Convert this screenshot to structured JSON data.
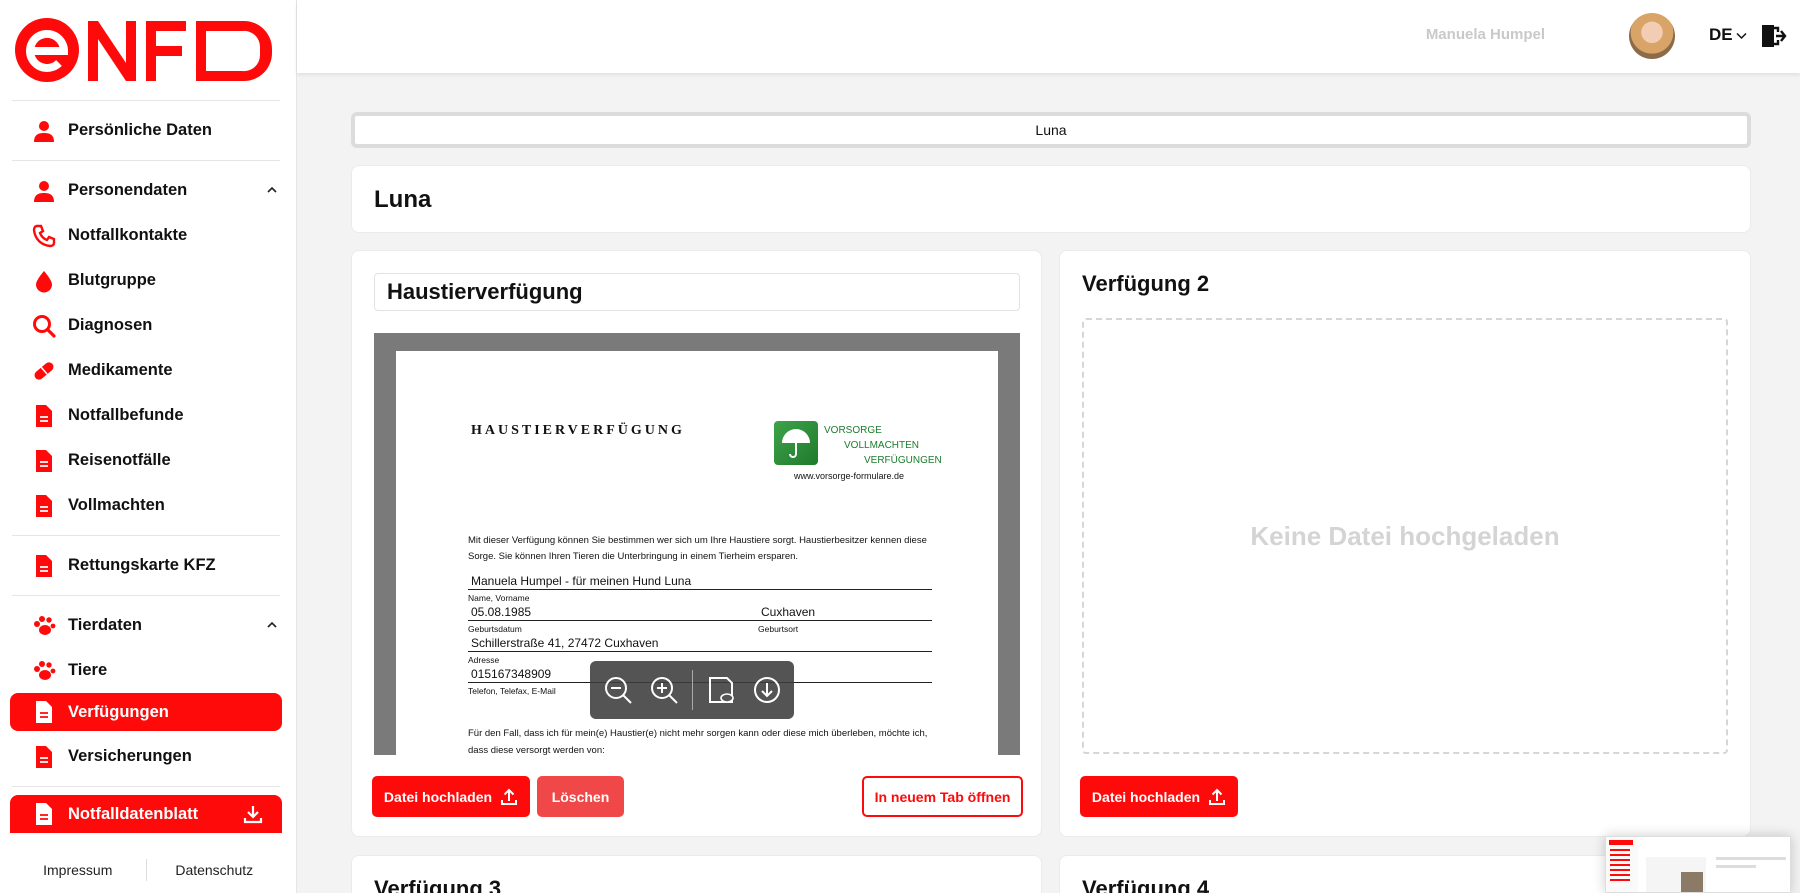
{
  "brand": {
    "name": "eNFD",
    "color": "#ff0a0a"
  },
  "header": {
    "username": "Manuela Humpel",
    "language": "DE"
  },
  "sidebar": {
    "items": [
      {
        "label": "Persönliche Daten",
        "icon": "person-icon"
      },
      {
        "label": "Personendaten",
        "icon": "person-icon"
      },
      {
        "label": "Notfallkontakte",
        "icon": "phone-icon"
      },
      {
        "label": "Blutgruppe",
        "icon": "drop-icon"
      },
      {
        "label": "Diagnosen",
        "icon": "search-icon"
      },
      {
        "label": "Medikamente",
        "icon": "pill-icon"
      },
      {
        "label": "Notfallbefunde",
        "icon": "document-icon"
      },
      {
        "label": "Reisenotfälle",
        "icon": "document-icon"
      },
      {
        "label": "Vollmachten",
        "icon": "document-icon"
      },
      {
        "label": "Rettungskarte KFZ",
        "icon": "document-icon"
      },
      {
        "label": "Tierdaten",
        "icon": "paw-icon"
      },
      {
        "label": "Tiere",
        "icon": "paw-icon"
      },
      {
        "label": "Verfügungen",
        "icon": "document-icon"
      },
      {
        "label": "Versicherungen",
        "icon": "document-icon"
      },
      {
        "label": "Notfalldatenblatt",
        "icon": "document-icon"
      }
    ],
    "footer": {
      "impressum": "Impressum",
      "datenschutz": "Datenschutz"
    }
  },
  "main": {
    "selector": "Luna",
    "title": "Luna",
    "card1": {
      "title": "Haustierverfügung",
      "buttons": {
        "upload": "Datei hochladen",
        "delete": "Löschen",
        "newtab": "In neuem Tab öffnen"
      }
    },
    "card2": {
      "title": "Verfügung 2",
      "empty": "Keine Datei hochgeladen",
      "upload": "Datei hochladen"
    },
    "card3": {
      "title": "Verfügung 3"
    },
    "card4": {
      "title": "Verfügung 4"
    }
  },
  "document": {
    "heading": "HAUSTIERVERFÜGUNG",
    "logo_lines": [
      "VORSORGE",
      "VOLLMACHTEN",
      "VERFÜGUNGEN"
    ],
    "logo_url": "www.vorsorge-formulare.de",
    "intro": "Mit dieser Verfügung können Sie bestimmen wer sich um Ihre Haustiere sorgt. Haustierbesitzer kennen diese Sorge. Sie können Ihren Tieren die Unterbringung in einem Tierheim ersparen.",
    "name_value": "Manuela Humpel - für meinen Hund Luna",
    "name_label": "Name, Vorname",
    "birthdate_value": "05.08.1985",
    "birthplace_value": "Cuxhaven",
    "birthdate_label": "Geburtsdatum",
    "birthplace_label": "Geburtsort",
    "address_value": "Schillerstraße 41, 27472 Cuxhaven",
    "address_label": "Adresse",
    "phone_value": "015167348909",
    "phone_label": "Telefon, Telefax, E-Mail",
    "para": "Für den Fall, dass ich für mein(e) Haustier(e) nicht mehr sorgen kann oder diese mich überleben, möchte ich, dass diese versorgt werden von:"
  }
}
